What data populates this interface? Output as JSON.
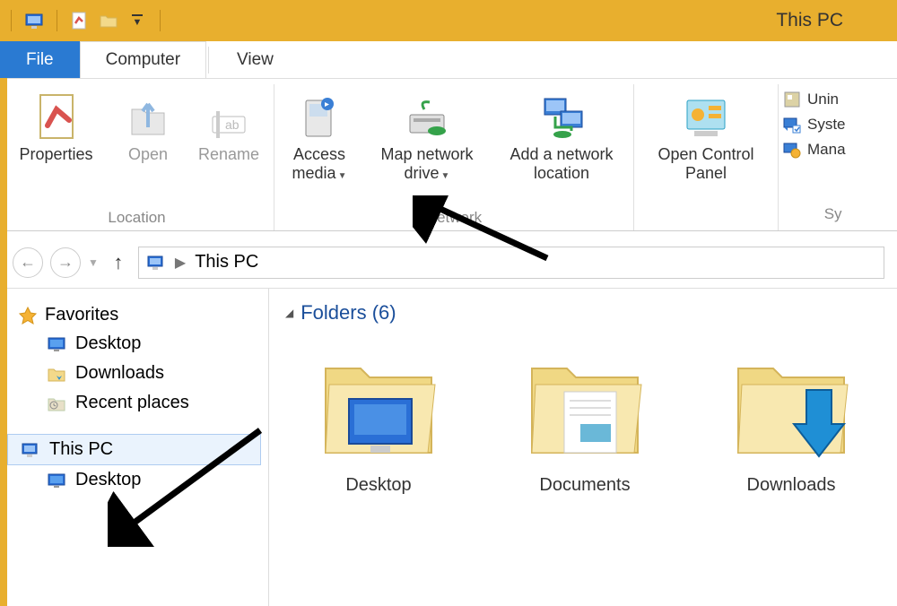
{
  "window": {
    "title": "This PC"
  },
  "quick_access": {
    "items": [
      "pc-icon",
      "properties-icon",
      "new-folder-icon"
    ],
    "dropdown": true
  },
  "tabs": {
    "file": "File",
    "items": [
      {
        "label": "Computer",
        "active": true
      },
      {
        "label": "View",
        "active": false
      }
    ]
  },
  "ribbon": {
    "groups": [
      {
        "label": "Location",
        "buttons": [
          {
            "id": "properties",
            "label": "Properties",
            "dropdown": false,
            "disabled": false
          },
          {
            "id": "open",
            "label": "Open",
            "dropdown": false,
            "disabled": true
          },
          {
            "id": "rename",
            "label": "Rename",
            "dropdown": false,
            "disabled": true
          }
        ]
      },
      {
        "label": "Network",
        "buttons": [
          {
            "id": "access-media",
            "label_line1": "Access",
            "label_line2": "media",
            "dropdown": true
          },
          {
            "id": "map-network-drive",
            "label_line1": "Map network",
            "label_line2": "drive",
            "dropdown": true
          },
          {
            "id": "add-network-location",
            "label_line1": "Add a network",
            "label_line2": "location",
            "dropdown": false
          }
        ]
      },
      {
        "label": "",
        "buttons": [
          {
            "id": "open-control-panel",
            "label_line1": "Open Control",
            "label_line2": "Panel",
            "dropdown": false
          }
        ]
      }
    ],
    "side_group": {
      "label_prefix": "Sy",
      "items": [
        {
          "id": "uninstall",
          "label": "Unin"
        },
        {
          "id": "system-properties",
          "label": "Syste"
        },
        {
          "id": "manage",
          "label": "Mana"
        }
      ]
    }
  },
  "nav": {
    "back_enabled": false,
    "forward_enabled": false,
    "breadcrumb": [
      "This PC"
    ]
  },
  "sidebar": {
    "favorites": {
      "label": "Favorites",
      "items": [
        {
          "id": "desktop",
          "label": "Desktop"
        },
        {
          "id": "downloads",
          "label": "Downloads"
        },
        {
          "id": "recent",
          "label": "Recent places"
        }
      ]
    },
    "this_pc": {
      "label": "This PC",
      "selected": true,
      "items": [
        {
          "id": "desktop2",
          "label": "Desktop"
        }
      ]
    }
  },
  "main": {
    "group_header": "Folders (6)",
    "folders": [
      {
        "id": "desktop",
        "label": "Desktop"
      },
      {
        "id": "documents",
        "label": "Documents"
      },
      {
        "id": "downloads",
        "label": "Downloads"
      }
    ]
  }
}
